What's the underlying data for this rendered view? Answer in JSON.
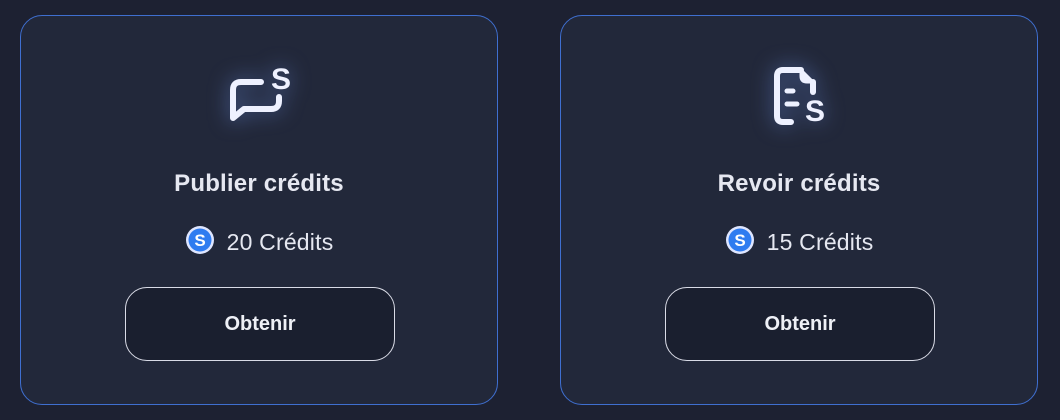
{
  "colors": {
    "background": "#1d2132",
    "card_background": "#22283a",
    "card_border": "#3f6fd0",
    "text": "#e6e8f1",
    "coin_blue": "#2f7cf0"
  },
  "cards": [
    {
      "icon": "message-dollar-icon",
      "title": "Publier crédits",
      "credits_text": "20 Crédits",
      "button_label": "Obtenir"
    },
    {
      "icon": "document-dollar-icon",
      "title": "Revoir crédits",
      "credits_text": "15 Crédits",
      "button_label": "Obtenir"
    }
  ]
}
